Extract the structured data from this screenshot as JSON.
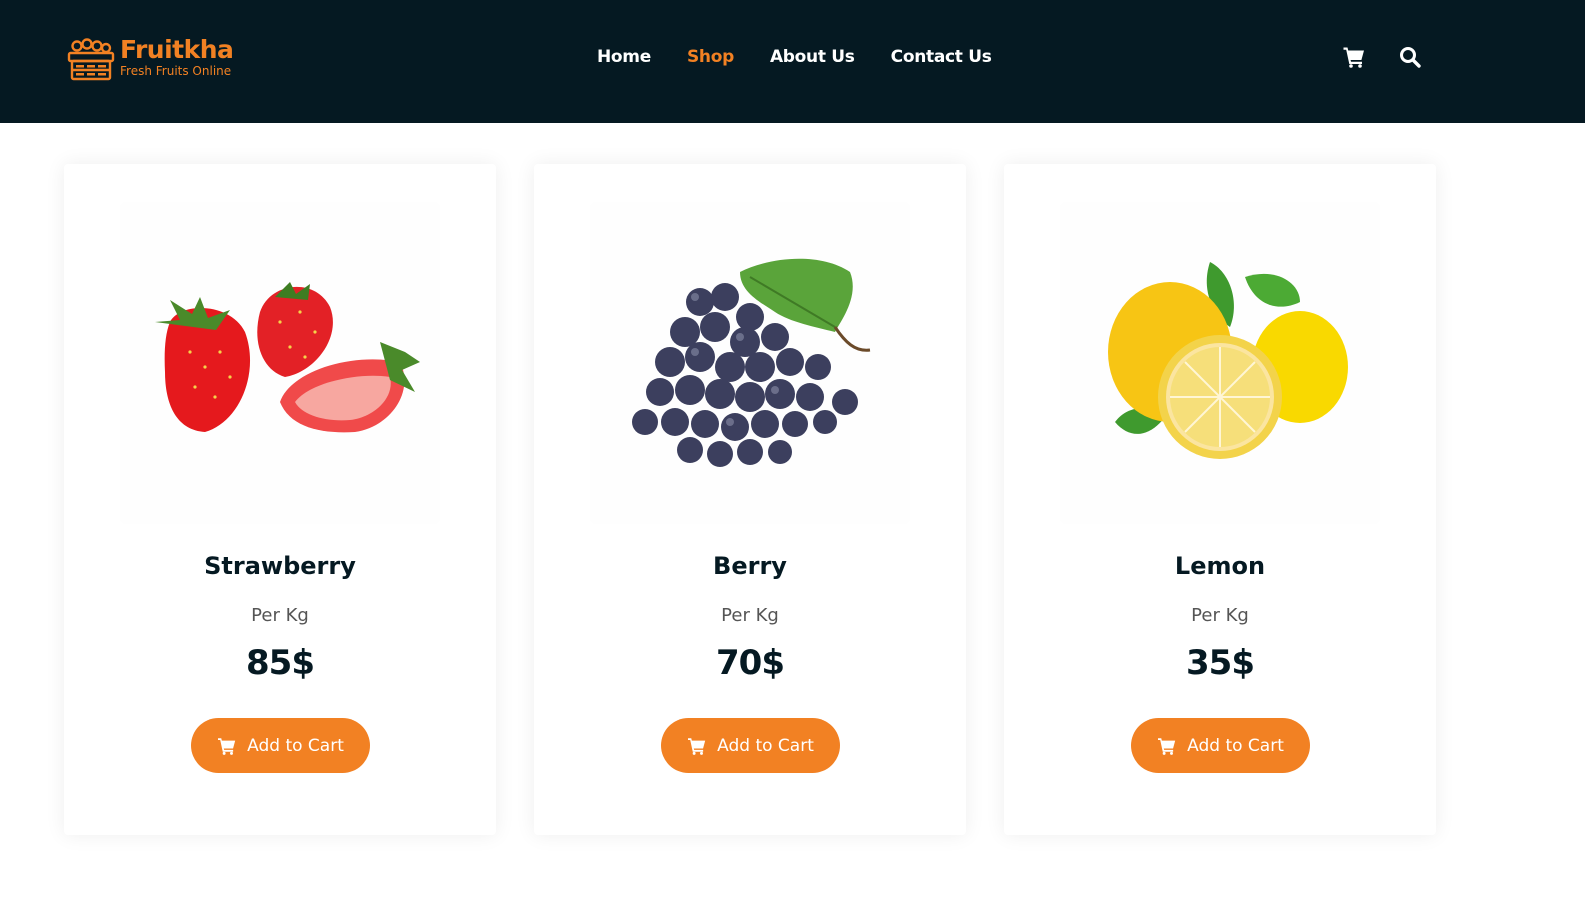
{
  "brand": {
    "title": "Fruitkha",
    "subtitle": "Fresh Fruits Online"
  },
  "nav": {
    "links": [
      {
        "label": "Home",
        "active": false
      },
      {
        "label": "Shop",
        "active": true
      },
      {
        "label": "About Us",
        "active": false
      },
      {
        "label": "Contact Us",
        "active": false
      }
    ],
    "icons": [
      "cart-icon",
      "search-icon"
    ]
  },
  "colors": {
    "navbar_bg": "#051922",
    "accent": "#f28123",
    "text_dark": "#051922"
  },
  "products": [
    {
      "name": "Strawberry",
      "unit": "Per Kg",
      "price": "85$",
      "button": "Add to Cart",
      "image": "strawberry-image"
    },
    {
      "name": "Berry",
      "unit": "Per Kg",
      "price": "70$",
      "button": "Add to Cart",
      "image": "grapes-image"
    },
    {
      "name": "Lemon",
      "unit": "Per Kg",
      "price": "35$",
      "button": "Add to Cart",
      "image": "lemon-image"
    }
  ]
}
